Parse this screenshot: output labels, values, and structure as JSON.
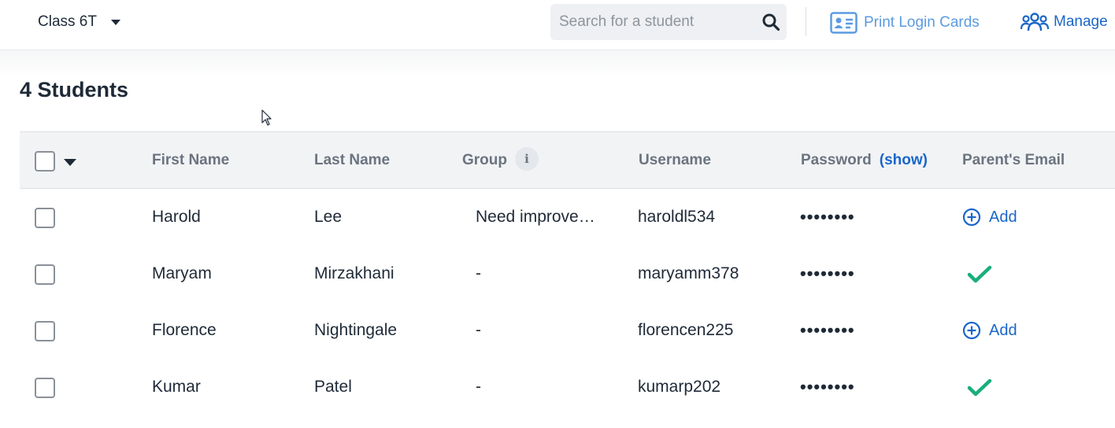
{
  "header": {
    "class_name": "Class 6T",
    "search": {
      "placeholder": "Search for a student",
      "value": ""
    },
    "print_label": "Print Login Cards",
    "manage_label": "Manage"
  },
  "main": {
    "title": "4 Students"
  },
  "table": {
    "columns": {
      "first_name": "First Name",
      "last_name": "Last Name",
      "group": "Group",
      "group_info": "i",
      "username": "Username",
      "password": "Password",
      "password_show": "(show)",
      "parent_email": "Parent's Email"
    },
    "rows": [
      {
        "first": "Harold",
        "last": "Lee",
        "group": "Need improvement",
        "username": "haroldl534",
        "password": "••••••••",
        "parent_email": "add",
        "add_label": "Add"
      },
      {
        "first": "Maryam",
        "last": "Mirzakhani",
        "group": "-",
        "username": "maryamm378",
        "password": "••••••••",
        "parent_email": "done",
        "add_label": ""
      },
      {
        "first": "Florence",
        "last": "Nightingale",
        "group": "-",
        "username": "florencen225",
        "password": "••••••••",
        "parent_email": "add",
        "add_label": "Add"
      },
      {
        "first": "Kumar",
        "last": "Patel",
        "group": "-",
        "username": "kumarp202",
        "password": "••••••••",
        "parent_email": "done",
        "add_label": ""
      }
    ]
  },
  "colors": {
    "link": "#1a66c9",
    "link_light": "#5b9be0",
    "success": "#1aae7a",
    "header_bg": "#f2f3f5"
  },
  "icons": {
    "search": "search-icon",
    "print": "id-card-icon",
    "manage": "users-icon",
    "add": "plus-circle-icon",
    "done": "checkmark-icon",
    "class_dropdown": "caret-down-icon"
  }
}
